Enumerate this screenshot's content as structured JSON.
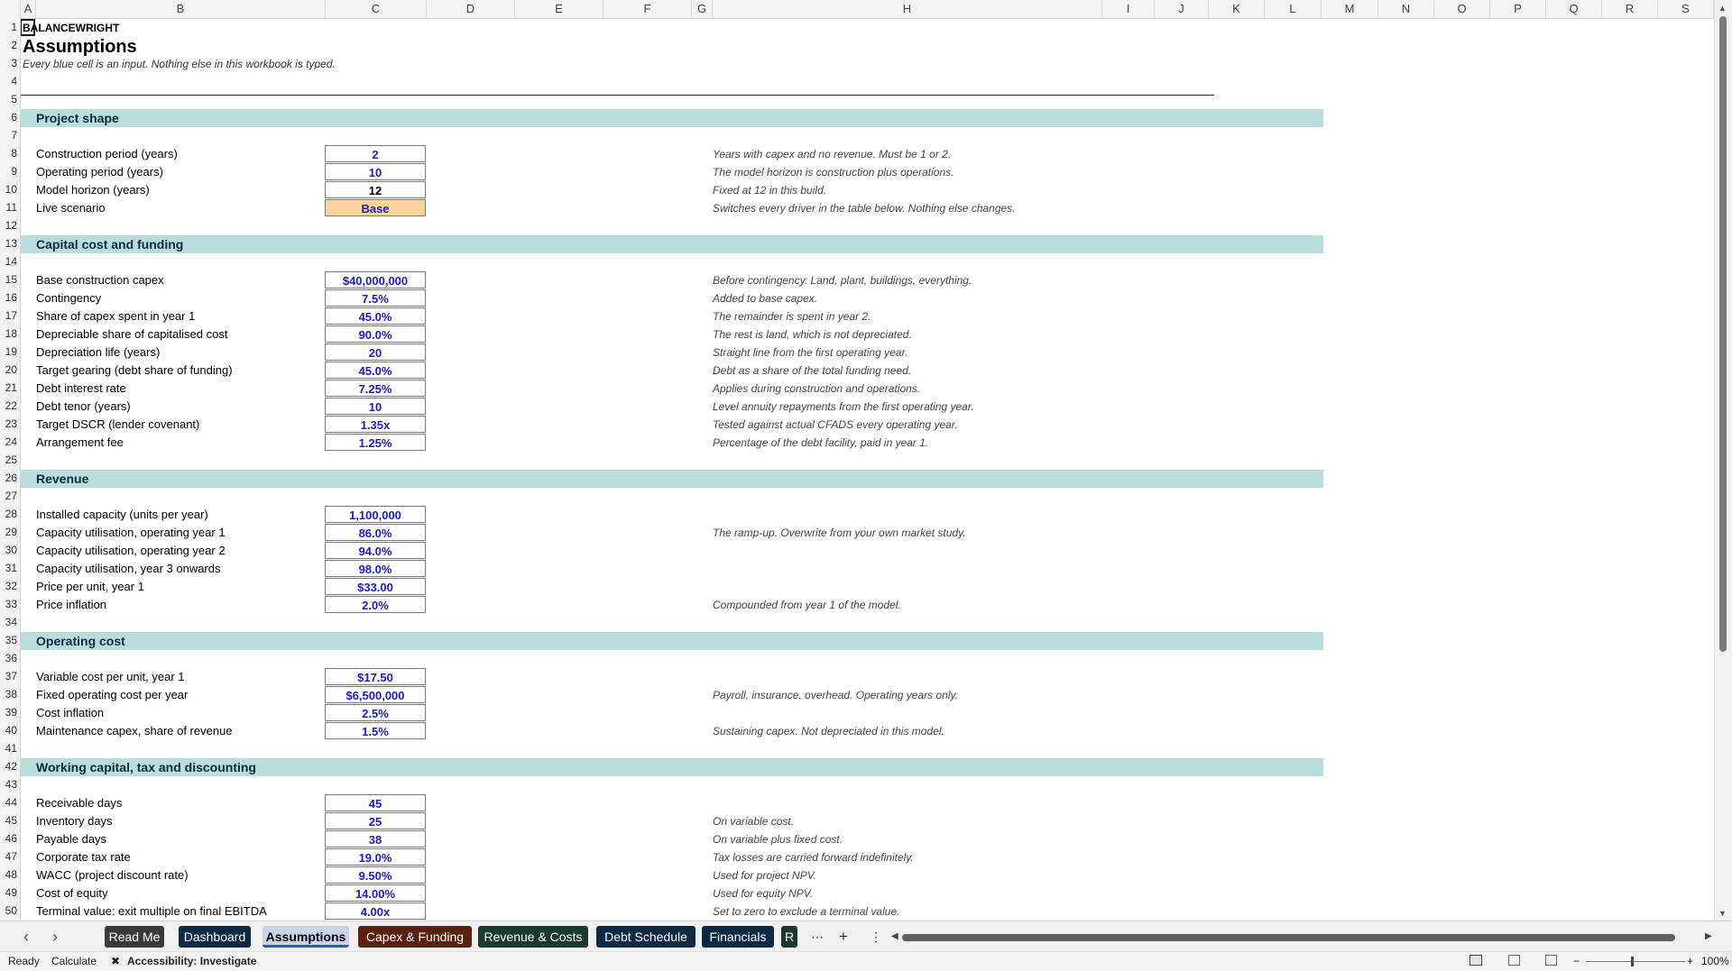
{
  "columns": [
    "A",
    "B",
    "C",
    "D",
    "E",
    "F",
    "G",
    "H",
    "I",
    "J",
    "K",
    "L",
    "M",
    "N",
    "O",
    "P",
    "Q",
    "R",
    "S"
  ],
  "rows": [
    "1",
    "2",
    "3",
    "4",
    "5",
    "6",
    "7",
    "8",
    "9",
    "10",
    "11",
    "12",
    "13",
    "14",
    "15",
    "16",
    "17",
    "18",
    "19",
    "20",
    "21",
    "22",
    "23",
    "24",
    "25",
    "26",
    "27",
    "28",
    "29",
    "30",
    "31",
    "32",
    "33",
    "34",
    "35",
    "36",
    "37",
    "38",
    "39",
    "40",
    "41",
    "42",
    "43",
    "44",
    "45",
    "46",
    "47",
    "48",
    "49",
    "50"
  ],
  "sheet": {
    "brand": "BALANCEWRIGHT",
    "title": "Assumptions",
    "subtitle": "Every blue cell is an input. Nothing else in this workbook is typed.",
    "sections": [
      {
        "title": "Project shape",
        "items": [
          {
            "label": "Construction period (years)",
            "value": "2",
            "note": "Years with capex and no revenue. Must be 1 or 2."
          },
          {
            "label": "Operating period (years)",
            "value": "10",
            "note": "The model horizon is construction plus operations."
          },
          {
            "label": "Model horizon (years)",
            "value": "12",
            "note": "Fixed at 12 in this build."
          },
          {
            "label": "Live scenario",
            "value": "Base",
            "note": "Switches every driver in the table below. Nothing else changes."
          }
        ]
      },
      {
        "title": "Capital cost and funding",
        "items": [
          {
            "label": "Base construction capex",
            "value": "$40,000,000",
            "note": "Before contingency. Land, plant, buildings, everything."
          },
          {
            "label": "Contingency",
            "value": "7.5%",
            "note": "Added to base capex."
          },
          {
            "label": "Share of capex spent in year 1",
            "value": "45.0%",
            "note": "The remainder is spent in year 2."
          },
          {
            "label": "Depreciable share of capitalised cost",
            "value": "90.0%",
            "note": "The rest is land, which is not depreciated."
          },
          {
            "label": "Depreciation life (years)",
            "value": "20",
            "note": "Straight line from the first operating year."
          },
          {
            "label": "Target gearing (debt share of funding)",
            "value": "45.0%",
            "note": "Debt as a share of the total funding need."
          },
          {
            "label": "Debt interest rate",
            "value": "7.25%",
            "note": "Applies during construction and operations."
          },
          {
            "label": "Debt tenor (years)",
            "value": "10",
            "note": "Level annuity repayments from the first operating year."
          },
          {
            "label": "Target DSCR (lender covenant)",
            "value": "1.35x",
            "note": "Tested against actual CFADS every operating year."
          },
          {
            "label": "Arrangement fee",
            "value": "1.25%",
            "note": "Percentage of the debt facility, paid in year 1."
          }
        ]
      },
      {
        "title": "Revenue",
        "items": [
          {
            "label": "Installed capacity (units per year)",
            "value": "1,100,000",
            "note": ""
          },
          {
            "label": "Capacity utilisation, operating year 1",
            "value": "86.0%",
            "note": "The ramp-up. Overwrite from your own market study."
          },
          {
            "label": "Capacity utilisation, operating year 2",
            "value": "94.0%",
            "note": ""
          },
          {
            "label": "Capacity utilisation, year 3 onwards",
            "value": "98.0%",
            "note": ""
          },
          {
            "label": "Price per unit, year 1",
            "value": "$33.00",
            "note": ""
          },
          {
            "label": "Price inflation",
            "value": "2.0%",
            "note": "Compounded from year 1 of the model."
          }
        ]
      },
      {
        "title": "Operating cost",
        "items": [
          {
            "label": "Variable cost per unit, year 1",
            "value": "$17.50",
            "note": ""
          },
          {
            "label": "Fixed operating cost per year",
            "value": "$6,500,000",
            "note": "Payroll, insurance, overhead. Operating years only."
          },
          {
            "label": "Cost inflation",
            "value": "2.5%",
            "note": ""
          },
          {
            "label": "Maintenance capex, share of revenue",
            "value": "1.5%",
            "note": "Sustaining capex. Not depreciated in this model."
          }
        ]
      },
      {
        "title": "Working capital, tax and discounting",
        "items": [
          {
            "label": "Receivable days",
            "value": "45",
            "note": ""
          },
          {
            "label": "Inventory days",
            "value": "25",
            "note": "On variable cost."
          },
          {
            "label": "Payable days",
            "value": "38",
            "note": "On variable plus fixed cost."
          },
          {
            "label": "Corporate tax rate",
            "value": "19.0%",
            "note": "Tax losses are carried forward indefinitely."
          },
          {
            "label": "WACC (project discount rate)",
            "value": "9.50%",
            "note": "Used for project NPV."
          },
          {
            "label": "Cost of equity",
            "value": "14.00%",
            "note": "Used for equity NPV."
          },
          {
            "label": "Terminal value: exit multiple on final EBITDA",
            "value": "4.00x",
            "note": "Set to zero to exclude a terminal value."
          }
        ]
      }
    ]
  },
  "tabs": [
    {
      "label": "Read Me",
      "bg": "#3a3a3a",
      "fg": "#ffffff"
    },
    {
      "label": "Dashboard",
      "bg": "#0d2a45",
      "fg": "#ffffff"
    },
    {
      "label": "Assumptions",
      "bg": "#c9d3e3",
      "fg": "#000000"
    },
    {
      "label": "Capex & Funding",
      "bg": "#5a2113",
      "fg": "#ffffff"
    },
    {
      "label": "Revenue & Costs",
      "bg": "#1a3b2c",
      "fg": "#ffffff"
    },
    {
      "label": "Debt Schedule",
      "bg": "#0d2a45",
      "fg": "#ffffff"
    },
    {
      "label": "Financials",
      "bg": "#0d2a45",
      "fg": "#ffffff"
    },
    {
      "label": "R",
      "bg": "#1a3b2c",
      "fg": "#ffffff"
    }
  ],
  "tabbar": {
    "more": "⋯",
    "add": "+",
    "options": "⋮",
    "prev": "‹",
    "next": "›",
    "scroll_left": "◀",
    "scroll_right": "▶"
  },
  "statusbar": {
    "ready": "Ready",
    "calculate": "Calculate",
    "accessibility": "Accessibility: Investigate",
    "zoom": "100%",
    "minus": "−",
    "plus": "+"
  },
  "colors": {
    "input": "#1a1adb",
    "band": "#b9dcdd",
    "scenario": "#fbd39b"
  }
}
